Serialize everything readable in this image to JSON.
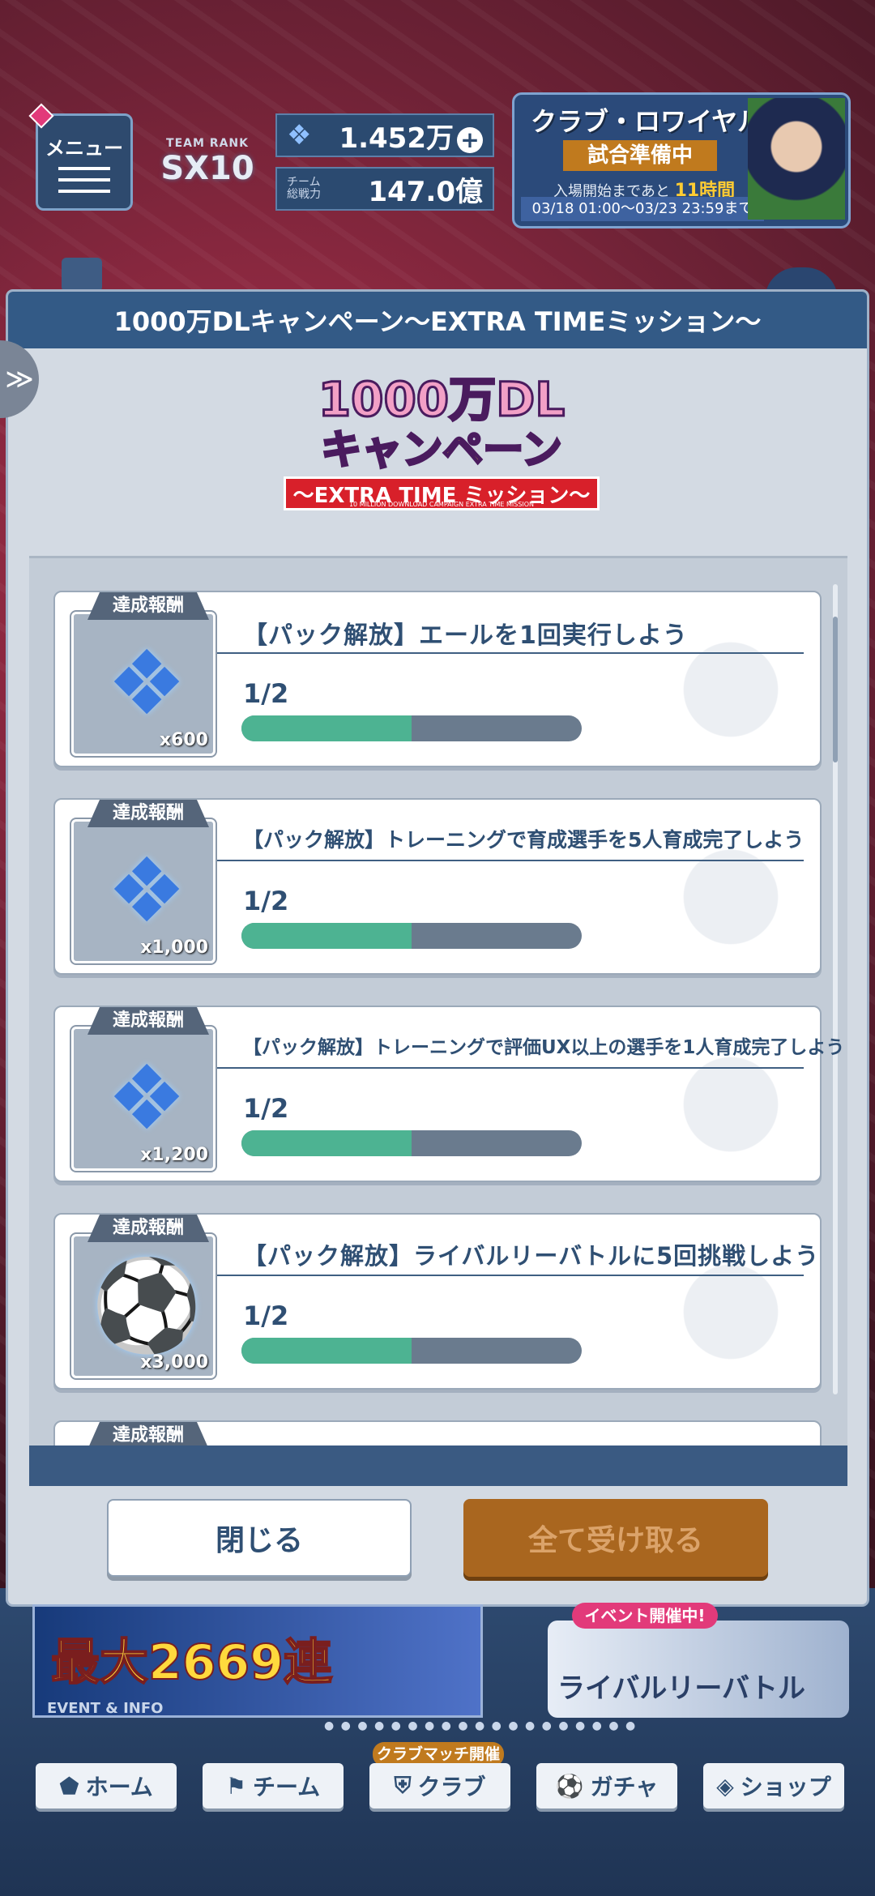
{
  "hud": {
    "menu_label": "メニュー",
    "team_rank_label": "TEAM RANK",
    "team_rank_value": "SX10",
    "currency_value": "1.452万",
    "power_label": "チーム\n総戦力",
    "power_value": "147.0億",
    "royal": {
      "title": "クラブ・ロワイヤル",
      "status": "試合準備中",
      "sub_prefix": "入場開始まであと",
      "sub_time": "11時間",
      "range": "03/18 01:00〜03/23 23:59まで"
    }
  },
  "modal": {
    "title": "1000万DLキャンペーン〜EXTRA TIMEミッション〜",
    "banner": {
      "line1": "1000万DL",
      "line2": "キャンペーン",
      "line3": "〜EXTRA TIME ミッション〜",
      "line4": "10 MILLION DOWNLOAD CAMPAIGN EXTRA TIME MISSION"
    },
    "missions": [
      {
        "tag": "達成報酬",
        "title": "【パック解放】エールを1回実行しよう",
        "progress_text": "1/2",
        "progress": 0.5,
        "quantity": "x600",
        "icon": "gem-icon"
      },
      {
        "tag": "達成報酬",
        "title": "【パック解放】トレーニングで育成選手を5人育成完了しよう",
        "progress_text": "1/2",
        "progress": 0.5,
        "quantity": "x1,000",
        "icon": "gem-icon"
      },
      {
        "tag": "達成報酬",
        "title": "【パック解放】トレーニングで評価UX以上の選手を1人育成完了しよう",
        "progress_text": "1/2",
        "progress": 0.5,
        "quantity": "x1,200",
        "icon": "gem-icon"
      },
      {
        "tag": "達成報酬",
        "title": "【パック解放】ライバルリーバトルに5回挑戦しよう",
        "progress_text": "1/2",
        "progress": 0.5,
        "quantity": "x3,000",
        "icon": "ball-icon"
      },
      {
        "tag": "達成報酬",
        "title": "",
        "progress_text": "",
        "progress": 0,
        "quantity": "",
        "icon": ""
      }
    ],
    "close_label": "閉じる",
    "claim_all_label": "全て受け取る"
  },
  "bottom": {
    "event_big": "最大2669連",
    "event_label": "EVENT & INFO",
    "rival_badge": "イベント開催中!",
    "rival_name": "ライバルリーバトル",
    "club_badge": "クラブマッチ開催中",
    "tabs": [
      {
        "label": "ホーム",
        "icon": "home-icon"
      },
      {
        "label": "チーム",
        "icon": "team-icon"
      },
      {
        "label": "クラブ",
        "icon": "club-icon"
      },
      {
        "label": "ガチャ",
        "icon": "gacha-icon"
      },
      {
        "label": "ショップ",
        "icon": "shop-icon"
      }
    ]
  }
}
